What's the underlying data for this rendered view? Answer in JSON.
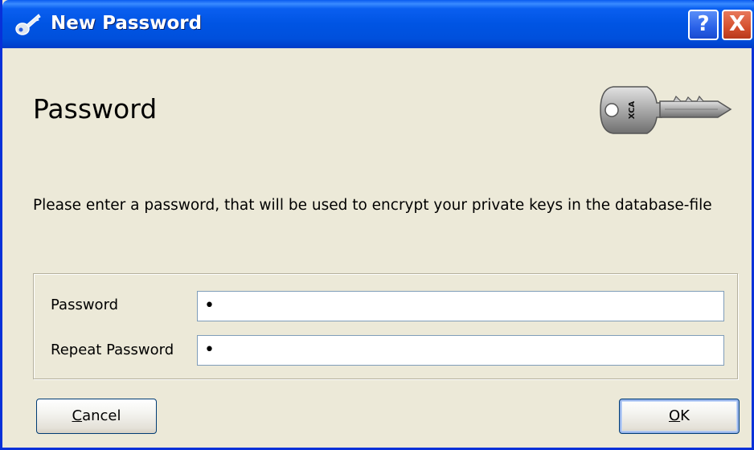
{
  "window": {
    "title": "New Password",
    "help_label": "?",
    "close_label": "X"
  },
  "dialog": {
    "heading": "Password",
    "description": "Please enter a password, that will be used to encrypt your private keys in the database-file",
    "key_image_text": "XCA"
  },
  "form": {
    "password_label": "Password",
    "password_value": "•",
    "repeat_label": "Repeat Password",
    "repeat_value": "•"
  },
  "buttons": {
    "cancel_label": "Cancel",
    "ok_label": "OK"
  },
  "colors": {
    "titlebar": "#0054e3",
    "dialog_bg": "#ece9d8",
    "input_border": "#7f9db9"
  }
}
